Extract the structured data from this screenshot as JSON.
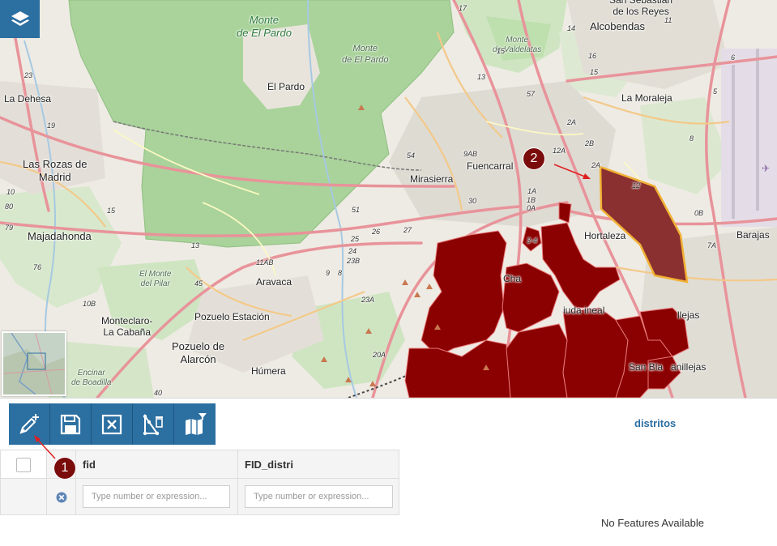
{
  "map": {
    "labels": {
      "monte_de_el_pardo_big": "Monte\nde El Pardo",
      "monte_de_el_pardo_small": "Monte\nde El Pardo",
      "monte_de_valdelatas": "Monte\nde Valdelatas",
      "el_monte_del_pilar": "El Monte\ndel Pilar",
      "encinar_de_boadilla": "Encinar\nde Boadilla",
      "el_pardo": "El Pardo",
      "alcobendas": "Alcobendas",
      "san_sebastian": "San Sebastián\nde los Reyes",
      "la_moraleja": "La Moraleja",
      "la_dehesa": "La Dehesa",
      "las_rozas": "Las Rozas de\nMadrid",
      "majadahonda": "Majadahonda",
      "mirasierra": "Mirasierra",
      "fuencarral": "Fuencarral",
      "hortaleza": "Hortaleza",
      "barajas": "Barajas",
      "aravaca": "Aravaca",
      "pozuelo_estacion": "Pozuelo Estación",
      "pozuelo_alarcon": "Pozuelo de\nAlarcón",
      "monteclaro": "Monteclaro-\nLa Cabaña",
      "humera": "Húmera",
      "chamartin": "Cha",
      "ciudad_lineal": "iuda   ineal",
      "san_blas": "San Bla",
      "canillejas": "anillejas",
      "villejas": "llejas"
    },
    "road_refs": [
      "17",
      "15",
      "13",
      "57",
      "12A",
      "2A",
      "2B",
      "9AB",
      "2A",
      "1A",
      "1B",
      "0A",
      "3-4",
      "23",
      "19",
      "15",
      "10",
      "54",
      "51",
      "25",
      "26",
      "27",
      "24",
      "23B",
      "23A",
      "20A",
      "45",
      "13",
      "11AB",
      "9",
      "8",
      "76",
      "79",
      "80",
      "10B",
      "12",
      "0B",
      "7A",
      "8",
      "6",
      "40",
      "30",
      "14",
      "16",
      "15",
      "11",
      "5"
    ],
    "markers": [
      {
        "number": "1"
      },
      {
        "number": "2"
      }
    ]
  },
  "toolbar": {
    "buttons": [
      {
        "name": "add-feature-button",
        "icon": "pencil-plus-icon"
      },
      {
        "name": "save-button",
        "icon": "floppy-disk-icon"
      },
      {
        "name": "cancel-edit-button",
        "icon": "close-box-icon"
      },
      {
        "name": "delete-geometry-button",
        "icon": "polygon-trash-icon"
      },
      {
        "name": "zoom-to-features-button",
        "icon": "map-filter-icon"
      }
    ]
  },
  "panel": {
    "layer_title": "distritos",
    "empty_message": "No Features Available"
  },
  "grid": {
    "columns": [
      {
        "key": "fid",
        "label": "fid",
        "placeholder": "Type number or expression..."
      },
      {
        "key": "FID_distri",
        "label": "FID_distri",
        "placeholder": "Type number or expression..."
      }
    ]
  },
  "colors": {
    "accent": "#2c6fa1",
    "district_fill": "#8b0000",
    "selected_fill": "#8a3030",
    "selected_stroke": "#f2b134",
    "marker": "#7a0c0c",
    "park": "#a9d39a"
  }
}
